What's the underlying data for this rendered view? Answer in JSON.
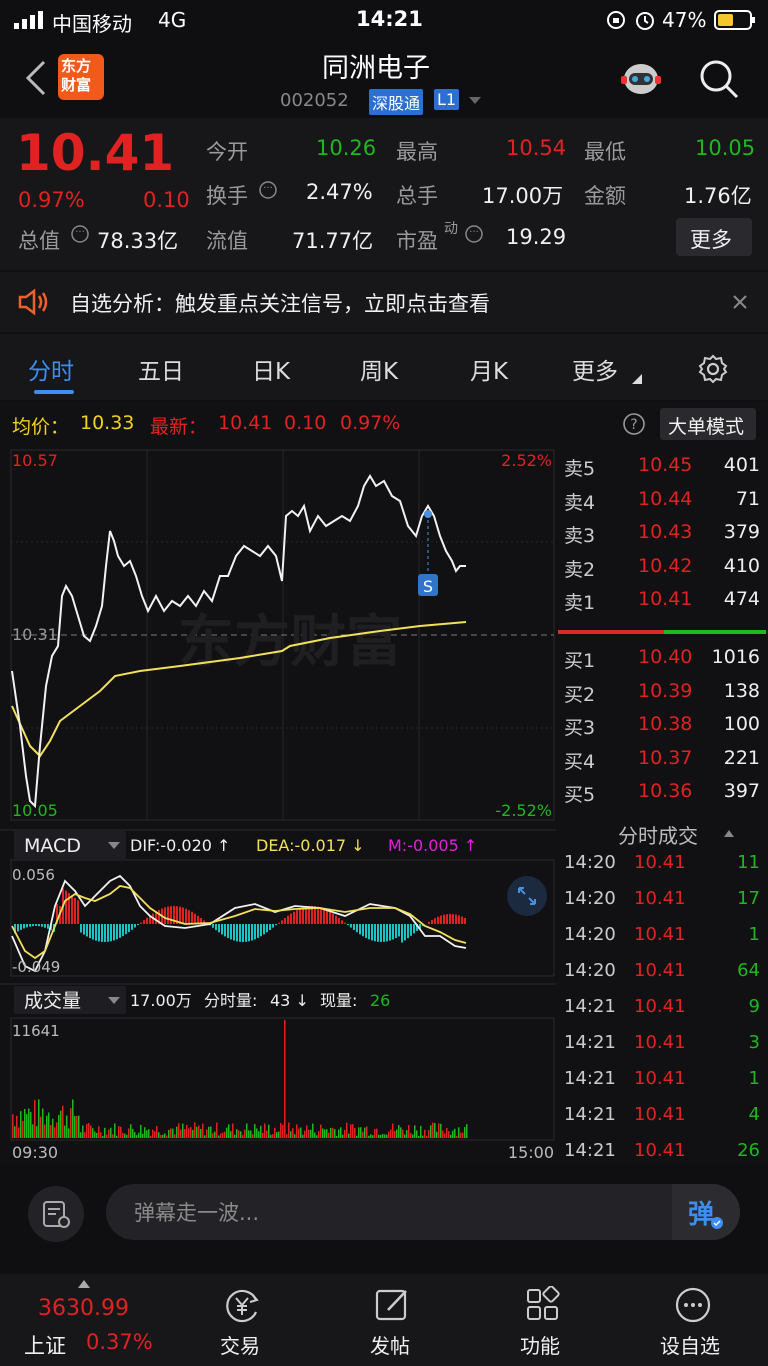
{
  "status": {
    "carrier": "中国移动",
    "network": "4G",
    "time": "14:21",
    "battery": "47%"
  },
  "nav": {
    "logo": "东方\n财富",
    "title": "同洲电子",
    "code": "002052",
    "tag": "深股通",
    "level": "L1"
  },
  "quote": {
    "price": "10.41",
    "change_pct": "0.97%",
    "change": "0.10",
    "open_label": "今开",
    "open": "10.26",
    "high_label": "最高",
    "high": "10.54",
    "low_label": "最低",
    "low": "10.05",
    "turnover_label": "换手",
    "turnover": "2.47%",
    "vol_label": "总手",
    "vol": "17.00万",
    "amount_label": "金额",
    "amount": "1.76亿",
    "mcap_label": "总值",
    "mcap": "78.33亿",
    "float_label": "流值",
    "float": "71.77亿",
    "pe_label": "市盈",
    "pe_sup": "动",
    "pe": "19.29",
    "more": "更多"
  },
  "banner": {
    "text": "自选分析：触发重点关注信号，立即点击查看"
  },
  "tabs": [
    "分时",
    "五日",
    "日K",
    "周K",
    "月K",
    "更多"
  ],
  "info": {
    "avg_label": "均价：",
    "avg": "10.33",
    "last_label": "最新：",
    "last": "10.41",
    "chg": "0.10",
    "pct": "0.97%",
    "mode": "大单模式"
  },
  "chart": {
    "y_top": "10.57",
    "y_mid": "10.31",
    "y_bot": "10.05",
    "pct_top": "2.52%",
    "pct_bot": "-2.52%",
    "marker": "S",
    "watermark": "东方财富"
  },
  "macd": {
    "label": "MACD",
    "dif": "DIF:-0.020 ↑",
    "dea": "DEA:-0.017 ↓",
    "m": "M:-0.005 ↑",
    "top": "0.056",
    "bot": "-0.049"
  },
  "volume": {
    "label": "成交量",
    "total": "17.00万",
    "fen_label": "分时量:",
    "fen": "43 ↓",
    "xian_label": "现量:",
    "xian": "26",
    "max": "11641",
    "t_start": "09:30",
    "t_end": "15:00"
  },
  "orderbook": {
    "sells": [
      {
        "label": "卖5",
        "price": "10.45",
        "vol": "401"
      },
      {
        "label": "卖4",
        "price": "10.44",
        "vol": "71"
      },
      {
        "label": "卖3",
        "price": "10.43",
        "vol": "379"
      },
      {
        "label": "卖2",
        "price": "10.42",
        "vol": "410"
      },
      {
        "label": "卖1",
        "price": "10.41",
        "vol": "474"
      }
    ],
    "buys": [
      {
        "label": "买1",
        "price": "10.40",
        "vol": "1016"
      },
      {
        "label": "买2",
        "price": "10.39",
        "vol": "138"
      },
      {
        "label": "买3",
        "price": "10.38",
        "vol": "100"
      },
      {
        "label": "买4",
        "price": "10.37",
        "vol": "221"
      },
      {
        "label": "买5",
        "price": "10.36",
        "vol": "397"
      }
    ]
  },
  "trades": {
    "title": "分时成交",
    "rows": [
      {
        "time": "14:20",
        "price": "10.41",
        "vol": "11"
      },
      {
        "time": "14:20",
        "price": "10.41",
        "vol": "17"
      },
      {
        "time": "14:20",
        "price": "10.41",
        "vol": "1"
      },
      {
        "time": "14:20",
        "price": "10.41",
        "vol": "64"
      },
      {
        "time": "14:21",
        "price": "10.41",
        "vol": "9"
      },
      {
        "time": "14:21",
        "price": "10.41",
        "vol": "3"
      },
      {
        "time": "14:21",
        "price": "10.41",
        "vol": "1"
      },
      {
        "time": "14:21",
        "price": "10.41",
        "vol": "4"
      },
      {
        "time": "14:21",
        "price": "10.41",
        "vol": "26"
      }
    ]
  },
  "comment": {
    "placeholder": "弹幕走一波...",
    "btn": "弹"
  },
  "bottom": {
    "index_value": "3630.99",
    "index_name": "上证",
    "index_pct": "0.37%",
    "trade": "交易",
    "post": "发帖",
    "func": "功能",
    "watch": "设自选"
  }
}
